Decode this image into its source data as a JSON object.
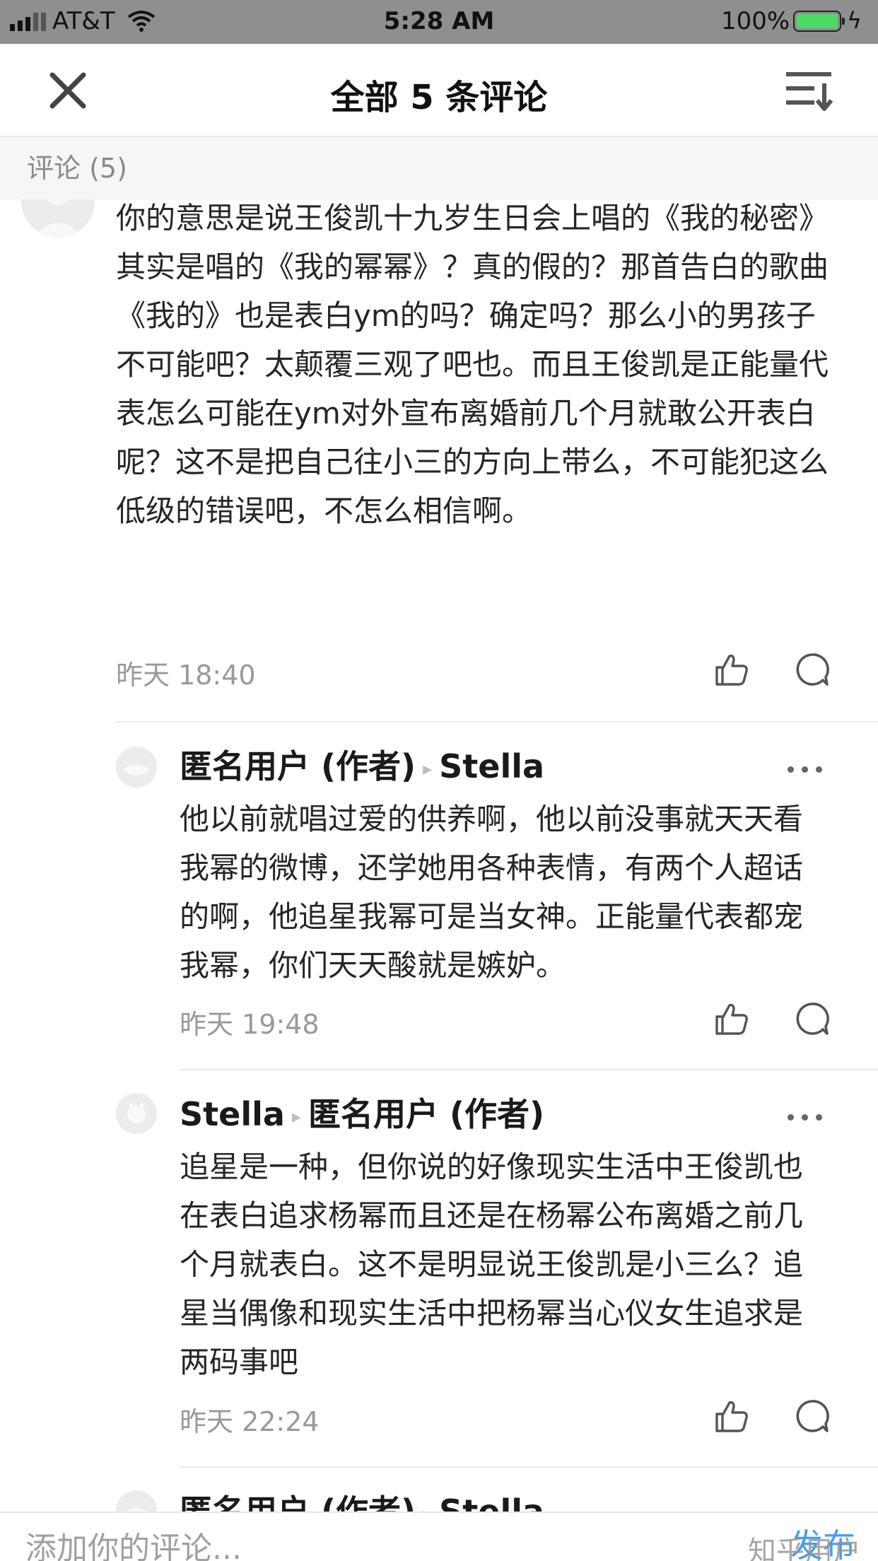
{
  "status_bar": {
    "carrier": "AT&T",
    "time": "5:28 AM",
    "battery_percent": "100%",
    "battery_level": 1.0,
    "battery_color": "#4cd964"
  },
  "header": {
    "title": "全部 5 条评论",
    "close_icon": "close-icon",
    "sort_icon": "sort-icon"
  },
  "section": {
    "label": "评论 (5)"
  },
  "comments": [
    {
      "author": "",
      "reply_to": "",
      "text": "你的意思是说王俊凯十九岁生日会上唱的《我的秘密》其实是唱的《我的幂幂》？真的假的？那首告白的歌曲《我的》也是表白ym的吗？确定吗？那么小的男孩子不可能吧？太颠覆三观了吧也。而且王俊凯是正能量代表怎么可能在ym对外宣布离婚前几个月就敢公开表白呢？这不是把自己往小三的方向上带么，不可能犯这么低级的错误吧，不怎么相信啊。",
      "time": "昨天 18:40"
    },
    {
      "author": "匿名用户 (作者)",
      "reply_to": "Stella",
      "text": "他以前就唱过爱的供养啊，他以前没事就天天看我幂的微博，还学她用各种表情，有两个人超话的啊，他追星我幂可是当女神。正能量代表都宠我幂，你们天天酸就是嫉妒。",
      "time": "昨天 19:48"
    },
    {
      "author": "Stella",
      "reply_to": "匿名用户 (作者)",
      "text": "追星是一种，但你说的好像现实生活中王俊凯也在表白追求杨幂而且还是在杨幂公布离婚之前几个月就表白。这不是明显说王俊凯是小三么？追星当偶像和现实生活中把杨幂当心仪女生追求是两码事吧",
      "time": "昨天 22:24"
    },
    {
      "author": "匿名用户 (作者)",
      "reply_to": "Stella",
      "text": "",
      "time": ""
    }
  ],
  "bottom_bar": {
    "placeholder": "添加你的评论...",
    "send_label": "发布",
    "watermark": "知乎用户"
  }
}
